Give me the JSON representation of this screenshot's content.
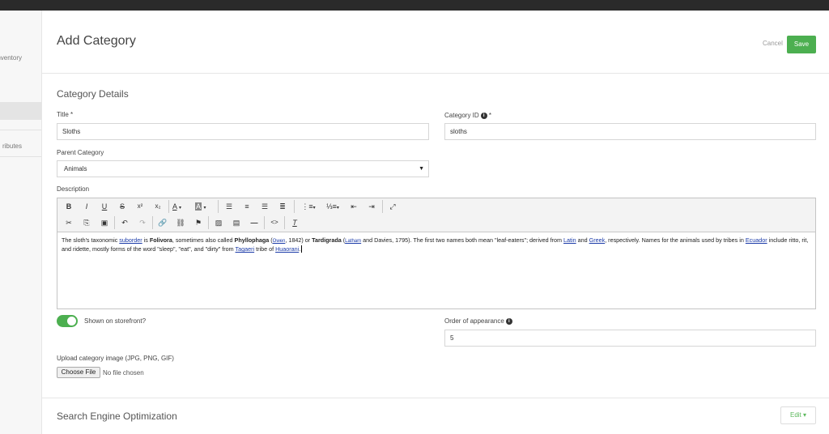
{
  "sidebar": {
    "items": [
      {
        "label": "Inventory"
      },
      {
        "label": "ributes"
      }
    ]
  },
  "header": {
    "title": "Add Category",
    "cancel_label": "Cancel",
    "save_label": "Save"
  },
  "details": {
    "section_title": "Category Details",
    "title_label": "Title *",
    "title_value": "Sloths",
    "category_id_label": "Category ID",
    "category_id_required": "*",
    "category_id_value": "sloths",
    "parent_label": "Parent Category",
    "parent_value": "Animals",
    "description_label": "Description"
  },
  "editor": {
    "toolbar_row1": [
      "B",
      "I",
      "U",
      "S",
      "x²",
      "x₂",
      "A",
      "A",
      "align-left",
      "align-center",
      "align-right",
      "justify",
      "bullets",
      "numbering",
      "outdent",
      "indent",
      "maximize"
    ],
    "toolbar_row2": [
      "cut",
      "copy",
      "paste",
      "undo",
      "redo",
      "link",
      "unlink",
      "anchor",
      "image",
      "media",
      "hr",
      "source",
      "clear-format"
    ],
    "content": {
      "t1": "The sloth's taxonomic ",
      "l_suborder": "suborder",
      "t2": " is ",
      "b_folivora": "Folivora",
      "t3": ", sometimes also called ",
      "b_phyllophaga": "Phyllophaga",
      "t4": " (",
      "l_owen": "Owen",
      "t5": ", 1842) or ",
      "b_tardigrada": "Tardigrada",
      "t6": " (",
      "l_latham": "Latham",
      "t7": " and Davies, 1795). The first two names both mean \"leaf-eaters\"; derived from ",
      "l_latin": "Latin",
      "t8": " and ",
      "l_greek": "Greek",
      "t9": ", respectively. Names for the animals used by tribes in ",
      "l_ecuador": "Ecuador",
      "t10": " include ritto, rit, and ridette, mostly forms of the word \"sleep\", \"eat\", and \"dirty\" from ",
      "l_tagaeri": "Tagaeri",
      "t11": " tribe of ",
      "l_huaorani": "Huaorani",
      "t12": "."
    }
  },
  "storefront": {
    "toggle_on": true,
    "label": "Shown on storefront?"
  },
  "order": {
    "label": "Order of appearance",
    "value": "5"
  },
  "upload": {
    "label": "Upload category image (JPG, PNG, GIF)",
    "button_label": "Choose File",
    "status": "No file chosen"
  },
  "seo": {
    "section_title": "Search Engine Optimization",
    "edit_label": "Edit ▾"
  },
  "colors": {
    "accent": "#4caf50",
    "topbar": "#2a2a2a",
    "link": "#1a3aa8"
  }
}
